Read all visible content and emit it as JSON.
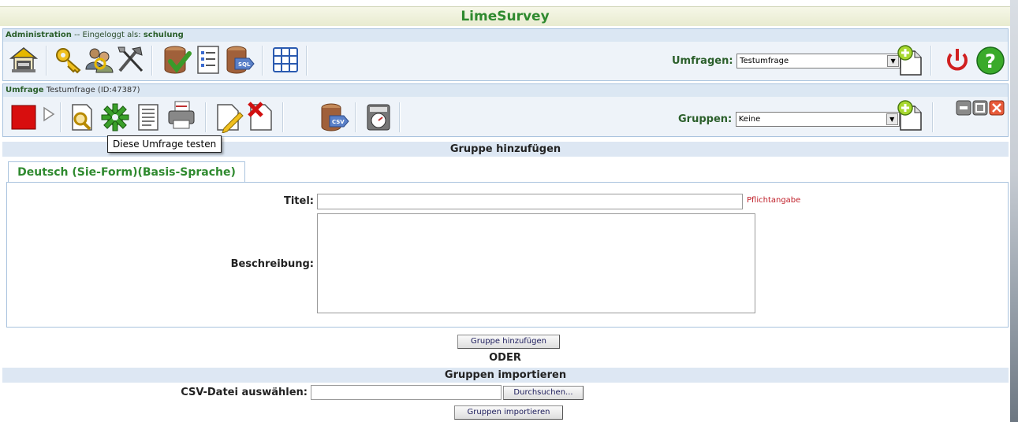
{
  "app": {
    "title": "LimeSurvey"
  },
  "admin": {
    "header_label": "Administration",
    "header_sep": "--",
    "logged_in_text": "Eingeloggt als:",
    "username": "schulung",
    "surveys_label": "Umfragen:",
    "surveys_selected": "Testumfrage",
    "icons": [
      "home-icon",
      "keys-icon",
      "users-icon",
      "tools-icon",
      "db-check-icon",
      "list-icon",
      "sql-icon",
      "table-icon",
      "add-survey-icon",
      "logout-icon",
      "help-icon"
    ]
  },
  "survey": {
    "header_label": "Umfrage",
    "name": "Testumfrage",
    "id_text": "(ID:47387)",
    "groups_label": "Gruppen:",
    "groups_selected": "Keine",
    "icons": [
      "stop-icon",
      "play-icon",
      "search-icon",
      "settings-icon",
      "document-icon",
      "print-icon",
      "edit-icon",
      "delete-icon",
      "csv-export-icon",
      "timer-icon",
      "add-group-icon",
      "minimize-icon",
      "maximize-icon",
      "close-icon"
    ]
  },
  "tooltip": {
    "text": "Diese Umfrage testen"
  },
  "add_group": {
    "section_title": "Gruppe hinzufügen",
    "language_tab": "Deutsch (Sie-Form)(Basis-Sprache)",
    "title_label": "Titel:",
    "title_value": "",
    "required_text": "Pflichtangabe",
    "description_label": "Beschreibung:",
    "description_value": "",
    "submit_label": "Gruppe hinzufügen"
  },
  "or_text": "ODER",
  "import": {
    "section_title": "Gruppen importieren",
    "file_label": "CSV-Datei auswählen:",
    "file_value": "",
    "browse_label": "Durchsuchen...",
    "submit_label": "Gruppen importieren"
  },
  "colors": {
    "brand_green": "#2f8a2f",
    "header_blue": "#dde7f3",
    "required_red": "#c0202a"
  }
}
